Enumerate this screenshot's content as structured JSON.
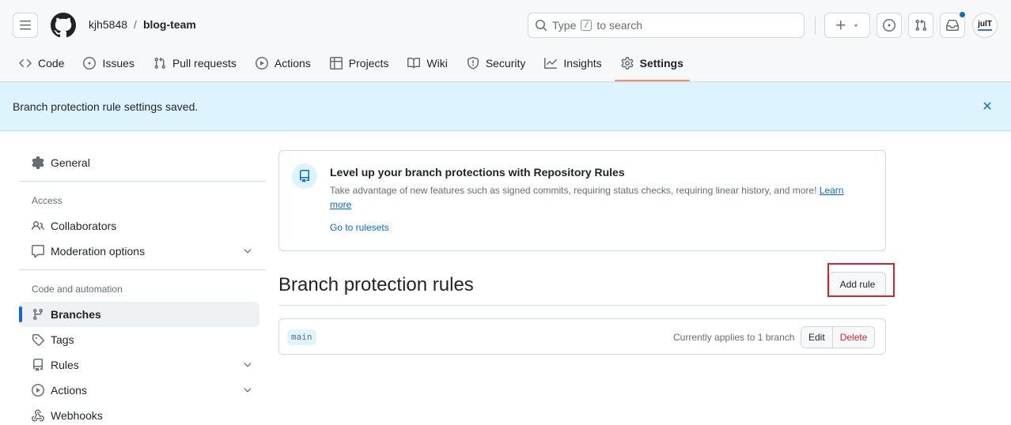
{
  "header": {
    "owner": "kjh5848",
    "separator": "/",
    "repo": "blog-team",
    "search": {
      "prefix": "Type",
      "key": "/",
      "suffix": "to search"
    },
    "avatar_text": "julT",
    "notification_dot_color": "#0969da"
  },
  "tabs": [
    {
      "label": "Code",
      "icon": "code-icon"
    },
    {
      "label": "Issues",
      "icon": "issue-icon"
    },
    {
      "label": "Pull requests",
      "icon": "pull-request-icon"
    },
    {
      "label": "Actions",
      "icon": "play-icon"
    },
    {
      "label": "Projects",
      "icon": "table-icon"
    },
    {
      "label": "Wiki",
      "icon": "book-icon"
    },
    {
      "label": "Security",
      "icon": "shield-icon"
    },
    {
      "label": "Insights",
      "icon": "graph-icon"
    },
    {
      "label": "Settings",
      "icon": "gear-icon",
      "active": true
    }
  ],
  "flash": {
    "message": "Branch protection rule settings saved."
  },
  "sidebar": {
    "general": "General",
    "access_heading": "Access",
    "collaborators": "Collaborators",
    "moderation": "Moderation options",
    "code_heading": "Code and automation",
    "branches": "Branches",
    "tags": "Tags",
    "rules": "Rules",
    "actions": "Actions",
    "webhooks": "Webhooks"
  },
  "banner": {
    "title": "Level up your branch protections with Repository Rules",
    "description": "Take advantage of new features such as signed commits, requiring status checks, requiring linear history, and more!",
    "learn_more": "Learn more",
    "go_to_rulesets": "Go to rulesets"
  },
  "branch_protection": {
    "title": "Branch protection rules",
    "add_rule": "Add rule",
    "rules": [
      {
        "branch": "main",
        "applies": "Currently applies to 1 branch",
        "edit": "Edit",
        "delete": "Delete"
      }
    ]
  },
  "colors": {
    "accent": "#0969da",
    "active_tab_underline": "#fd8c73",
    "danger": "#d1242f",
    "flash_bg": "#ddf4ff"
  }
}
